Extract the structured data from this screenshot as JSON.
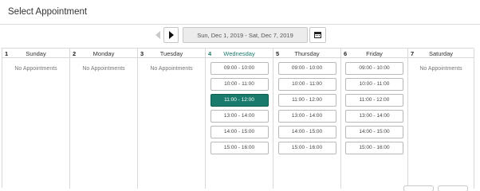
{
  "dialog": {
    "title": "Select Appointment"
  },
  "nav": {
    "date_range": "Sun, Dec 1, 2019 - Sat, Dec 7, 2019"
  },
  "days": [
    {
      "num": "1",
      "name": "Sunday",
      "empty_text": "No Appointments",
      "slots": []
    },
    {
      "num": "2",
      "name": "Monday",
      "empty_text": "No Appointments",
      "slots": []
    },
    {
      "num": "3",
      "name": "Tuesday",
      "empty_text": "No Appointments",
      "slots": []
    },
    {
      "num": "4",
      "name": "Wednesday",
      "today": true,
      "slots": [
        "09:00 - 10:00",
        "10:00 - 11:00",
        "11:00 - 12:00",
        "13:00 - 14:00",
        "14:00 - 15:00",
        "15:00 - 16:00"
      ],
      "selected": "11:00 - 12:00"
    },
    {
      "num": "5",
      "name": "Thursday",
      "slots": [
        "09:00 - 10:00",
        "10:00 - 11:00",
        "11:00 - 12:00",
        "13:00 - 14:00",
        "14:00 - 15:00",
        "15:00 - 16:00"
      ]
    },
    {
      "num": "6",
      "name": "Friday",
      "slots": [
        "09:00 - 10:00",
        "10:00 - 11:00",
        "11:00 - 12:00",
        "13:00 - 14:00",
        "14:00 - 15:00",
        "15:00 - 16:00"
      ]
    },
    {
      "num": "7",
      "name": "Saturday",
      "empty_text": "No Appointments",
      "slots": []
    }
  ],
  "colors": {
    "accent": "#1a7b6c",
    "border": "#d8d8d8"
  },
  "icons": {
    "prev": "chevron-left-icon",
    "next": "chevron-right-icon",
    "calendar": "calendar-icon"
  }
}
